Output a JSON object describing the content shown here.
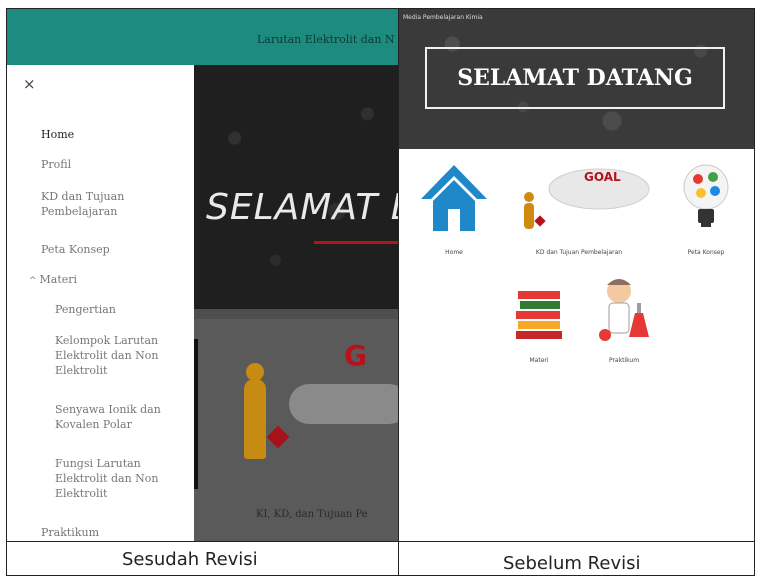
{
  "after": {
    "header_title": "Larutan Elektrolit dan N",
    "close_label": "×",
    "nav": [
      {
        "label": "Home"
      },
      {
        "label": "Profil"
      },
      {
        "label": "KD dan Tujuan Pembelajaran"
      },
      {
        "label": "Peta Konsep"
      },
      {
        "label": "Materi"
      },
      {
        "label": "Praktikum"
      }
    ],
    "materi_caret": "^",
    "materi_sub": [
      {
        "label": "Pengertian"
      },
      {
        "label": "Kelompok Larutan Elektrolit dan Non Elektrolit"
      },
      {
        "label": "Senyawa Ionik dan Kovalen Polar"
      },
      {
        "label": "Fungsi Larutan Elektrolit dan Non Elektrolit"
      }
    ],
    "hero_title": "SELAMAT D",
    "card_goal": "G",
    "card_caption": "KI, KD, dan Tujuan Pe"
  },
  "before": {
    "app_title": "Media Pembelajaran Kimia",
    "banner_title": "SELAMAT DATANG",
    "tiles": [
      {
        "label": "Home",
        "icon": "house-icon"
      },
      {
        "label": "KD dan Tujuan Pembelajaran",
        "icon": "goal-icon"
      },
      {
        "label": "Peta Konsep",
        "icon": "lightbulb-icon"
      },
      {
        "label": "Materi",
        "icon": "books-icon"
      },
      {
        "label": "Praktikum",
        "icon": "scientist-icon"
      }
    ]
  },
  "captions": {
    "left": "Sesudah Revisi",
    "right": "Sebelum Revisi"
  },
  "colors": {
    "header_teal": "#1d8b7f",
    "accent_red": "#b5121b",
    "house_blue": "#1e88c8"
  }
}
